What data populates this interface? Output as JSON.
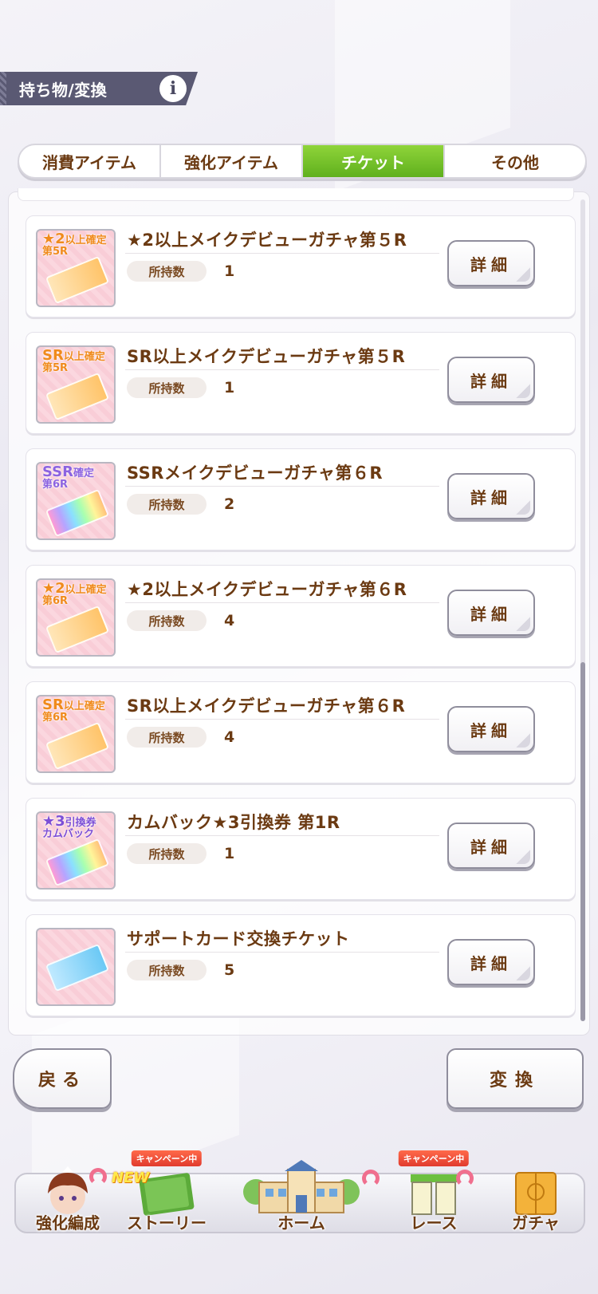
{
  "header": {
    "title": "持ち物/変換",
    "info_icon": "i"
  },
  "tabs": [
    {
      "label": "消費アイテム",
      "active": false
    },
    {
      "label": "強化アイテム",
      "active": false
    },
    {
      "label": "チケット",
      "active": true
    },
    {
      "label": "その他",
      "active": false
    }
  ],
  "qty_label": "所持数",
  "detail_label": "詳細",
  "items": [
    {
      "name": "★2以上メイクデビューガチャ第５R",
      "qty": "1",
      "thumb_line1": "★2",
      "thumb_line1b": "以上確定",
      "thumb_line2": "第5R"
    },
    {
      "name": "SR以上メイクデビューガチャ第５R",
      "qty": "1",
      "thumb_line1": "SR",
      "thumb_line1b": "以上確定",
      "thumb_line2": "第5R"
    },
    {
      "name": "SSRメイクデビューガチャ第６R",
      "qty": "2",
      "thumb_line1": "SSR",
      "thumb_line1b": "確定",
      "thumb_line2": "第6R"
    },
    {
      "name": "★2以上メイクデビューガチャ第６R",
      "qty": "4",
      "thumb_line1": "★2",
      "thumb_line1b": "以上確定",
      "thumb_line2": "第6R"
    },
    {
      "name": "SR以上メイクデビューガチャ第６R",
      "qty": "4",
      "thumb_line1": "SR",
      "thumb_line1b": "以上確定",
      "thumb_line2": "第6R"
    },
    {
      "name": "カムバック★3引換券 第1R",
      "qty": "1",
      "thumb_line1": "★3",
      "thumb_line1b": "引換券",
      "thumb_line2": "カムバック"
    },
    {
      "name": "サポートカード交換チケット",
      "qty": "5",
      "thumb_line1": "",
      "thumb_line1b": "",
      "thumb_line2": ""
    }
  ],
  "buttons": {
    "back": "戻る",
    "convert": "変換"
  },
  "nav": {
    "items": [
      {
        "label": "強化編成"
      },
      {
        "label": "ストーリー",
        "badge": "キャンペーン中",
        "new_badge": "NEW"
      },
      {
        "label": "ホーム"
      },
      {
        "label": "レース",
        "badge": "キャンペーン中"
      },
      {
        "label": "ガチャ"
      }
    ]
  }
}
